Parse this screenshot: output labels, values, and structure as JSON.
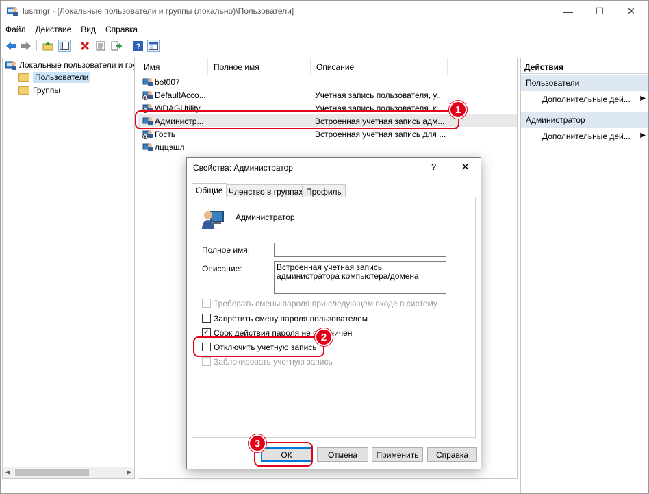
{
  "window": {
    "title": "lusrmgr - [Локальные пользователи и группы (локально)\\Пользователи]",
    "minimize": "—",
    "maximize": "☐",
    "close": "✕"
  },
  "menu": [
    "Файл",
    "Действие",
    "Вид",
    "Справка"
  ],
  "toolbar": {
    "icons": [
      "back-icon",
      "forward-icon",
      "up-folder-icon",
      "show-hide-tree-icon",
      "delete-icon",
      "properties-icon",
      "export-icon",
      "help-icon",
      "view-icon"
    ]
  },
  "tree": {
    "root": "Локальные пользователи и гру",
    "items": [
      {
        "label": "Пользователи",
        "selected": true
      },
      {
        "label": "Группы",
        "selected": false
      }
    ]
  },
  "list": {
    "columns": [
      "Имя",
      "Полное имя",
      "Описание"
    ],
    "rows": [
      {
        "name": "bot007",
        "fullname": "",
        "desc": ""
      },
      {
        "name": "DefaultAcco...",
        "fullname": "",
        "desc": "Учетная запись пользователя, у..."
      },
      {
        "name": "WDAGUtility...",
        "fullname": "",
        "desc": "Учетная запись пользователя, к..."
      },
      {
        "name": "Администр...",
        "fullname": "",
        "desc": "Встроенная учетная запись адм..."
      },
      {
        "name": "Гость",
        "fullname": "",
        "desc": "Встроенная учетная запись для ..."
      },
      {
        "name": "лццэшл",
        "fullname": "",
        "desc": ""
      }
    ]
  },
  "actions": {
    "title": "Действия",
    "sections": [
      {
        "label": "Пользователи",
        "item": "Дополнительные дей..."
      },
      {
        "label": "Администратор",
        "item": "Дополнительные дей..."
      }
    ]
  },
  "dialog": {
    "title": "Свойства: Администратор",
    "help": "?",
    "close": "✕",
    "tabs": [
      "Общие",
      "Членство в группах",
      "Профиль"
    ],
    "username": "Администратор",
    "fullname_label": "Полное имя:",
    "fullname_value": "",
    "desc_label": "Описание:",
    "desc_value": "Встроенная учетная запись администратора компьютера/домена",
    "checkboxes": [
      {
        "label": "Требовать смены пароля при следующем входе в систему",
        "checked": false,
        "disabled": true
      },
      {
        "label": "Запретить смену пароля пользователем",
        "checked": false,
        "disabled": false
      },
      {
        "label": "Срок действия пароля не ограничен",
        "checked": true,
        "disabled": false
      },
      {
        "label": "Отключить учетную запись",
        "checked": false,
        "disabled": false
      },
      {
        "label": "Заблокировать учетную запись",
        "checked": false,
        "disabled": true
      }
    ],
    "buttons": {
      "ok": "ОК",
      "cancel": "Отмена",
      "apply": "Применить",
      "help": "Справка"
    }
  },
  "callouts": [
    "1",
    "2",
    "3"
  ],
  "colors": {
    "accent": "#0078d7",
    "callout": "#e3001b",
    "selection": "#cce4f7",
    "actions_section": "#dde8f3"
  }
}
